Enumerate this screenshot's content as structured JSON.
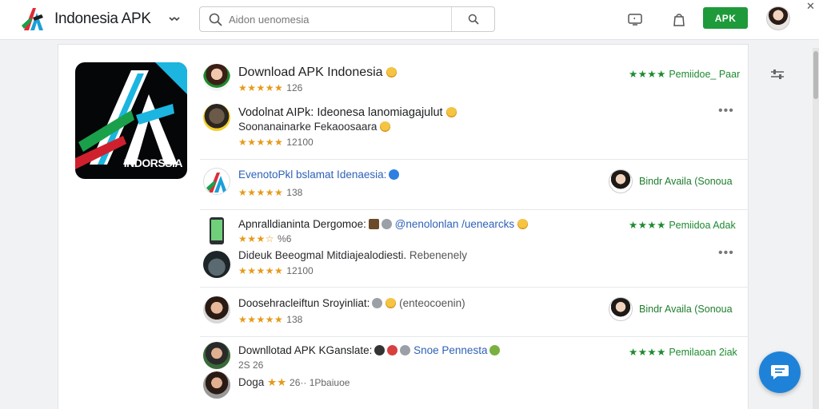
{
  "header": {
    "brand": "Indonesia APK",
    "search_placeholder": "Aidon uenomesia",
    "apk_button": "APK"
  },
  "app": {
    "icon_label": "INDORSSIA"
  },
  "rows": [
    {
      "title": "Download APK Indonesia",
      "rating": "★★★★★",
      "count": "126",
      "tag_stars": "★★★★",
      "tag_text": "Pemiidoe_ Paar"
    },
    {
      "title": "Vodolnat AIPk: Ideonesa lanomiagajulut",
      "subtitle": "Soonanainarke Fekaoosaara",
      "rating": "★★★★★",
      "count": "12100"
    },
    {
      "title": "EvenotoPkl bslamat Idenaesia:",
      "rating": "★★★★★",
      "count": "138",
      "side_user": "Bindr Availa (Sonoua"
    },
    {
      "title": "Apnralldianinta Dergomoe:",
      "link": "@nenolonlan /uenearcks",
      "rating": "★★★☆",
      "count": "%6",
      "subtitle": "Dideuk Beeogmal Mitdiajealodiesti.",
      "subtitle_link": "Rebenenely",
      "rating2": "★★★★★",
      "count2": "12100",
      "tag_stars": "★★★★",
      "tag_text": "Pemiidoa Adak"
    },
    {
      "title": "Doosehracleiftun Sroyinliat:",
      "paren": "(enteocoenin)",
      "rating": "★★★★★",
      "count": "138",
      "side_user": "Bindr Availa (Sonoua"
    },
    {
      "title": "Downllotad APK KGanslate:",
      "link": "Snoe Pennesta",
      "sub_count": "2S 26",
      "tag_stars": "★★★★",
      "tag_text": "Pemilaoan 2iak",
      "bottom_label": "Doga",
      "bottom_rating": "★★",
      "bottom_text": "26·· 1Pbaiuoe"
    }
  ],
  "colors": {
    "accent_green": "#1e9a3a",
    "star_orange": "#e69a1a",
    "link_blue": "#2f62b8",
    "fab_blue": "#1e83d8"
  },
  "icons": [
    "logo-icon",
    "chevron-down-icon",
    "search-icon",
    "tv-icon",
    "bag-icon",
    "filter-icon",
    "chat-icon",
    "more-icon"
  ]
}
